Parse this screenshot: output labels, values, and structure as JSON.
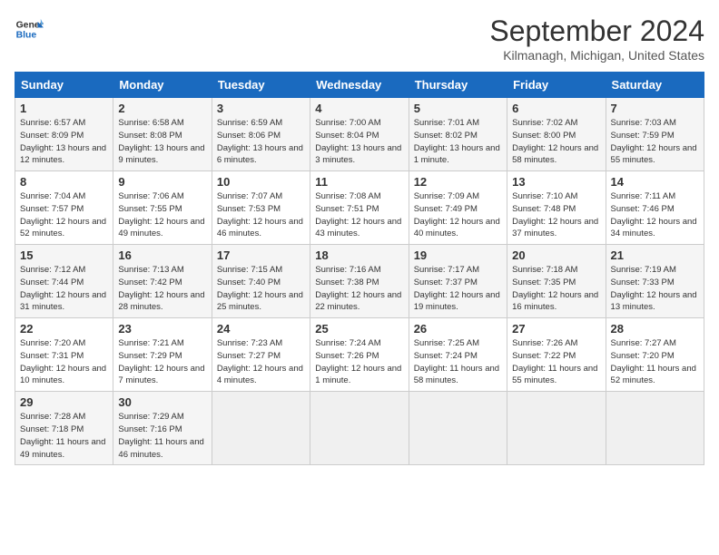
{
  "header": {
    "logo_line1": "General",
    "logo_line2": "Blue",
    "title": "September 2024",
    "subtitle": "Kilmanagh, Michigan, United States"
  },
  "days_of_week": [
    "Sunday",
    "Monday",
    "Tuesday",
    "Wednesday",
    "Thursday",
    "Friday",
    "Saturday"
  ],
  "weeks": [
    [
      {
        "day": 1,
        "details": "Sunrise: 6:57 AM\nSunset: 8:09 PM\nDaylight: 13 hours\nand 12 minutes."
      },
      {
        "day": 2,
        "details": "Sunrise: 6:58 AM\nSunset: 8:08 PM\nDaylight: 13 hours\nand 9 minutes."
      },
      {
        "day": 3,
        "details": "Sunrise: 6:59 AM\nSunset: 8:06 PM\nDaylight: 13 hours\nand 6 minutes."
      },
      {
        "day": 4,
        "details": "Sunrise: 7:00 AM\nSunset: 8:04 PM\nDaylight: 13 hours\nand 3 minutes."
      },
      {
        "day": 5,
        "details": "Sunrise: 7:01 AM\nSunset: 8:02 PM\nDaylight: 13 hours\nand 1 minute."
      },
      {
        "day": 6,
        "details": "Sunrise: 7:02 AM\nSunset: 8:00 PM\nDaylight: 12 hours\nand 58 minutes."
      },
      {
        "day": 7,
        "details": "Sunrise: 7:03 AM\nSunset: 7:59 PM\nDaylight: 12 hours\nand 55 minutes."
      }
    ],
    [
      {
        "day": 8,
        "details": "Sunrise: 7:04 AM\nSunset: 7:57 PM\nDaylight: 12 hours\nand 52 minutes."
      },
      {
        "day": 9,
        "details": "Sunrise: 7:06 AM\nSunset: 7:55 PM\nDaylight: 12 hours\nand 49 minutes."
      },
      {
        "day": 10,
        "details": "Sunrise: 7:07 AM\nSunset: 7:53 PM\nDaylight: 12 hours\nand 46 minutes."
      },
      {
        "day": 11,
        "details": "Sunrise: 7:08 AM\nSunset: 7:51 PM\nDaylight: 12 hours\nand 43 minutes."
      },
      {
        "day": 12,
        "details": "Sunrise: 7:09 AM\nSunset: 7:49 PM\nDaylight: 12 hours\nand 40 minutes."
      },
      {
        "day": 13,
        "details": "Sunrise: 7:10 AM\nSunset: 7:48 PM\nDaylight: 12 hours\nand 37 minutes."
      },
      {
        "day": 14,
        "details": "Sunrise: 7:11 AM\nSunset: 7:46 PM\nDaylight: 12 hours\nand 34 minutes."
      }
    ],
    [
      {
        "day": 15,
        "details": "Sunrise: 7:12 AM\nSunset: 7:44 PM\nDaylight: 12 hours\nand 31 minutes."
      },
      {
        "day": 16,
        "details": "Sunrise: 7:13 AM\nSunset: 7:42 PM\nDaylight: 12 hours\nand 28 minutes."
      },
      {
        "day": 17,
        "details": "Sunrise: 7:15 AM\nSunset: 7:40 PM\nDaylight: 12 hours\nand 25 minutes."
      },
      {
        "day": 18,
        "details": "Sunrise: 7:16 AM\nSunset: 7:38 PM\nDaylight: 12 hours\nand 22 minutes."
      },
      {
        "day": 19,
        "details": "Sunrise: 7:17 AM\nSunset: 7:37 PM\nDaylight: 12 hours\nand 19 minutes."
      },
      {
        "day": 20,
        "details": "Sunrise: 7:18 AM\nSunset: 7:35 PM\nDaylight: 12 hours\nand 16 minutes."
      },
      {
        "day": 21,
        "details": "Sunrise: 7:19 AM\nSunset: 7:33 PM\nDaylight: 12 hours\nand 13 minutes."
      }
    ],
    [
      {
        "day": 22,
        "details": "Sunrise: 7:20 AM\nSunset: 7:31 PM\nDaylight: 12 hours\nand 10 minutes."
      },
      {
        "day": 23,
        "details": "Sunrise: 7:21 AM\nSunset: 7:29 PM\nDaylight: 12 hours\nand 7 minutes."
      },
      {
        "day": 24,
        "details": "Sunrise: 7:23 AM\nSunset: 7:27 PM\nDaylight: 12 hours\nand 4 minutes."
      },
      {
        "day": 25,
        "details": "Sunrise: 7:24 AM\nSunset: 7:26 PM\nDaylight: 12 hours\nand 1 minute."
      },
      {
        "day": 26,
        "details": "Sunrise: 7:25 AM\nSunset: 7:24 PM\nDaylight: 11 hours\nand 58 minutes."
      },
      {
        "day": 27,
        "details": "Sunrise: 7:26 AM\nSunset: 7:22 PM\nDaylight: 11 hours\nand 55 minutes."
      },
      {
        "day": 28,
        "details": "Sunrise: 7:27 AM\nSunset: 7:20 PM\nDaylight: 11 hours\nand 52 minutes."
      }
    ],
    [
      {
        "day": 29,
        "details": "Sunrise: 7:28 AM\nSunset: 7:18 PM\nDaylight: 11 hours\nand 49 minutes."
      },
      {
        "day": 30,
        "details": "Sunrise: 7:29 AM\nSunset: 7:16 PM\nDaylight: 11 hours\nand 46 minutes."
      },
      {
        "day": null,
        "details": ""
      },
      {
        "day": null,
        "details": ""
      },
      {
        "day": null,
        "details": ""
      },
      {
        "day": null,
        "details": ""
      },
      {
        "day": null,
        "details": ""
      }
    ]
  ]
}
